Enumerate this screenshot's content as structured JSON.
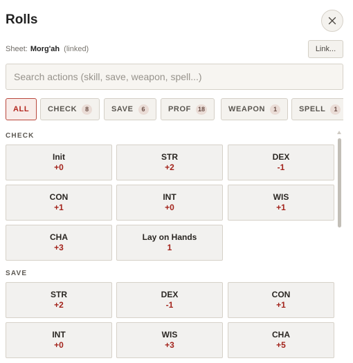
{
  "header": {
    "title": "Rolls",
    "close_icon": "close-icon"
  },
  "sheet": {
    "label": "Sheet:",
    "name": "Morg'ah",
    "status": "(linked)",
    "link_button": "Link..."
  },
  "search": {
    "placeholder": "Search actions (skill, save, weapon, spell...)",
    "value": ""
  },
  "filters": [
    {
      "label": "ALL",
      "count": null,
      "active": true
    },
    {
      "label": "CHECK",
      "count": "8",
      "active": false
    },
    {
      "label": "SAVE",
      "count": "6",
      "active": false
    },
    {
      "label": "PROF",
      "count": "18",
      "active": false
    },
    {
      "label": "WEAPON",
      "count": "1",
      "active": false
    },
    {
      "label": "SPELL",
      "count": "1",
      "active": false
    }
  ],
  "sections": {
    "check": {
      "title": "CHECK",
      "items": [
        {
          "label": "Init",
          "value": "+0"
        },
        {
          "label": "STR",
          "value": "+2"
        },
        {
          "label": "DEX",
          "value": "-1"
        },
        {
          "label": "CON",
          "value": "+1"
        },
        {
          "label": "INT",
          "value": "+0"
        },
        {
          "label": "WIS",
          "value": "+1"
        },
        {
          "label": "CHA",
          "value": "+3"
        },
        {
          "label": "Lay on Hands",
          "value": "1"
        }
      ]
    },
    "save": {
      "title": "SAVE",
      "items": [
        {
          "label": "STR",
          "value": "+2"
        },
        {
          "label": "DEX",
          "value": "-1"
        },
        {
          "label": "CON",
          "value": "+1"
        },
        {
          "label": "INT",
          "value": "+0"
        },
        {
          "label": "WIS",
          "value": "+3"
        },
        {
          "label": "CHA",
          "value": "+5"
        }
      ]
    }
  },
  "colors": {
    "accent": "#b3261e",
    "value": "#a3231b",
    "cell_bg": "#f2f1ef"
  }
}
